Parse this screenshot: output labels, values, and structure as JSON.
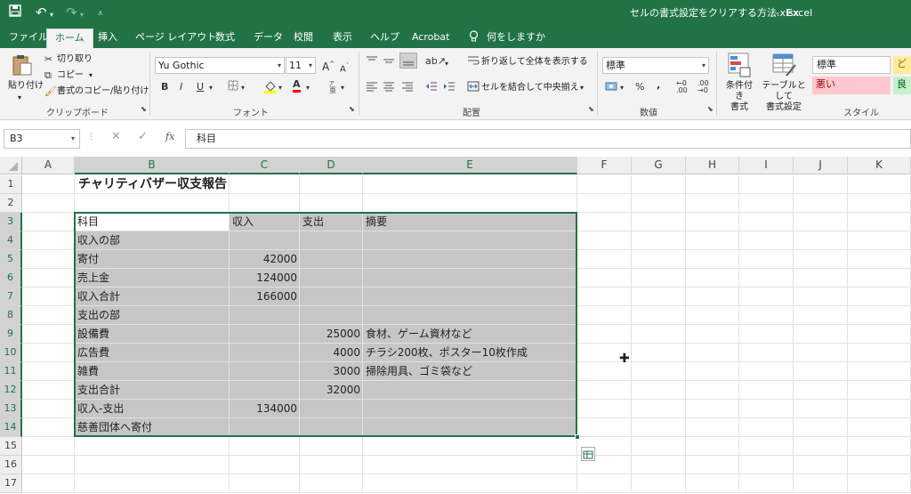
{
  "window": {
    "title": "セルの書式設定をクリアする方法.xlsx",
    "app": "Excel",
    "title_sep": "-"
  },
  "quick_access": {
    "save_icon": "save-icon",
    "undo_icon": "undo-icon",
    "redo_icon": "redo-icon",
    "customize_icon": "customize-icon"
  },
  "tabs": [
    "ファイル",
    "ホーム",
    "挿入",
    "ページ レイアウト",
    "数式",
    "データ",
    "校閲",
    "表示",
    "ヘルプ",
    "Acrobat"
  ],
  "tell_me": "何をしますか",
  "clipboard": {
    "paste": "貼り付け",
    "cut": "切り取り",
    "copy": "コピー",
    "format_painter": "書式のコピー/貼り付け",
    "group": "クリップボード"
  },
  "font": {
    "name": "Yu Gothic",
    "size": "11",
    "bold": "B",
    "italic": "I",
    "underline": "U",
    "font_color_letter": "A",
    "group": "フォント"
  },
  "alignment": {
    "wrap": "折り返して全体を表示する",
    "merge": "セルを結合して中央揃え",
    "group": "配置"
  },
  "number": {
    "format": "標準",
    "percent": "%",
    "comma": ",",
    "group": "数値"
  },
  "styles": {
    "conditional": "条件付き\n書式",
    "table": "テーブルとして\n書式設定",
    "normal": "標準",
    "bad": "悪い",
    "good": "良",
    "neutral": "ど",
    "group": "スタイル"
  },
  "formula_bar": {
    "name_box": "B3",
    "fx": "fx",
    "content": "科目"
  },
  "columns": [
    "A",
    "B",
    "C",
    "D",
    "E",
    "F",
    "G",
    "H",
    "I",
    "J",
    "K"
  ],
  "rows": [
    "1",
    "2",
    "3",
    "4",
    "5",
    "6",
    "7",
    "8",
    "9",
    "10",
    "11",
    "12",
    "13",
    "14",
    "15",
    "16",
    "17"
  ],
  "sheet": {
    "title": "チャリティバザー収支報告",
    "headers": [
      "科目",
      "収入",
      "支出",
      "摘要"
    ],
    "data": [
      [
        "収入の部",
        "",
        "",
        ""
      ],
      [
        "寄付",
        "42000",
        "",
        ""
      ],
      [
        "売上金",
        "124000",
        "",
        ""
      ],
      [
        "収入合計",
        "166000",
        "",
        ""
      ],
      [
        "支出の部",
        "",
        "",
        ""
      ],
      [
        "設備費",
        "",
        "25000",
        "食材、ゲーム資材など"
      ],
      [
        "広告費",
        "",
        "4000",
        "チラシ200枚、ポスター10枚作成"
      ],
      [
        "雑費",
        "",
        "3000",
        "掃除用具、ゴミ袋など"
      ],
      [
        "支出合計",
        "",
        "32000",
        ""
      ],
      [
        "収入-支出",
        "134000",
        "",
        ""
      ],
      [
        "慈善団体へ寄付",
        "",
        "",
        ""
      ]
    ]
  },
  "colors": {
    "accent": "#217346",
    "selection": "#c6c6c6"
  }
}
